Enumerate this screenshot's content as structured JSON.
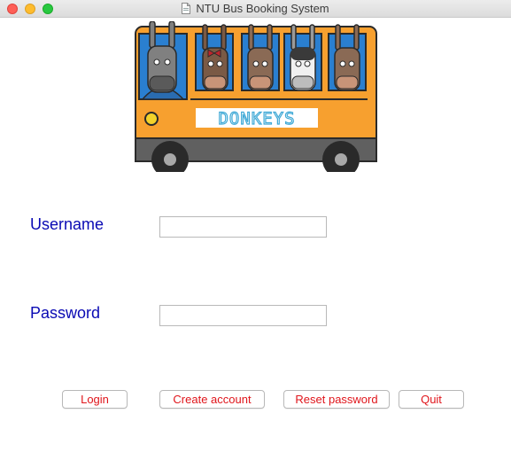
{
  "window": {
    "title": "NTU Bus Booking System"
  },
  "logo": {
    "text": "DONKEYS",
    "body_color": "#f7a02f",
    "window_color": "#2a7fd0"
  },
  "form": {
    "username_label": "Username",
    "username_value": "",
    "password_label": "Password",
    "password_value": ""
  },
  "buttons": {
    "login": "Login",
    "create_account": "Create account",
    "reset_password": "Reset password",
    "quit": "Quit"
  },
  "colors": {
    "label": "#0a0ab4",
    "button_text": "#e0151b"
  }
}
